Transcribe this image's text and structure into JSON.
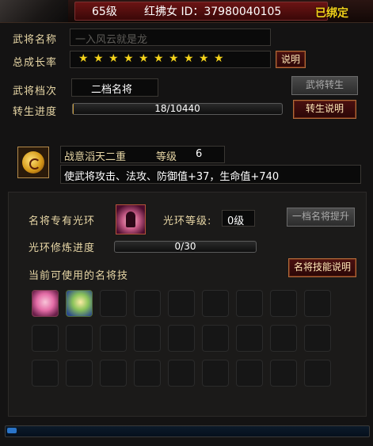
{
  "title": {
    "level": "65级",
    "name_id": "红拂女 ID：37980040105",
    "bound": "已绑定"
  },
  "general": {
    "name_label": "武将名称",
    "name_value": "一入风云就是龙",
    "growth_label": "总成长率",
    "growth_stars": "★ ★ ★ ★ ★ ★ ★ ★ ★ ★",
    "growth_help": "说明",
    "tier_label": "武将档次",
    "tier_value": "二档名将",
    "rebirth_button": "武将转生",
    "rebirth_progress_label": "转生进度",
    "rebirth_progress_text": "18/10440",
    "rebirth_progress_current": 18,
    "rebirth_progress_max": 10440,
    "rebirth_help": "转生说明"
  },
  "buff": {
    "icon": "yin-yang-orb-icon",
    "title": "战意滔天二重",
    "level_label": "等级",
    "level_value": "6",
    "description": "使武将攻击、法攻、防御值+37，生命值+740"
  },
  "aura": {
    "label": "名将专有光环",
    "level_label": "光环等级:",
    "level_value": "0级",
    "upgrade_button": "一档名将提升",
    "refine_label": "光环修炼进度",
    "refine_text": "0/30",
    "refine_current": 0,
    "refine_max": 30
  },
  "skills": {
    "label": "当前可使用的名将技",
    "help_button": "名将技能说明",
    "slots": [
      "pink-flame-skill-icon",
      "green-nature-skill-icon"
    ]
  },
  "colors": {
    "gold_text": "#e8d7a6",
    "star": "#f3d21a",
    "accent_red": "#6b1414",
    "scroll_thumb": "#2a74c8"
  }
}
